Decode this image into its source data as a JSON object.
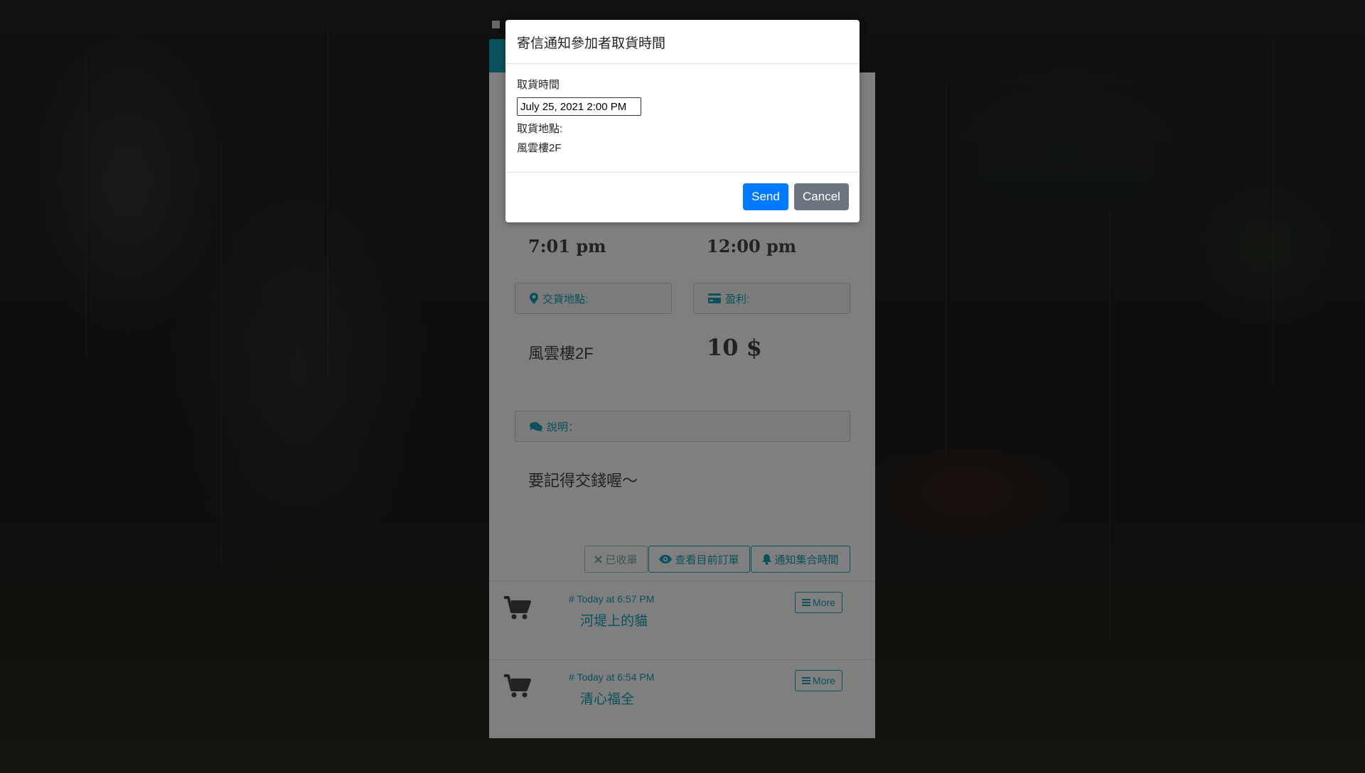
{
  "background": {
    "theme": "rainy-window-photo"
  },
  "card": {
    "start_time": "7:01 pm",
    "end_time": "12:00 pm",
    "location_label": "交貨地點:",
    "location_value": "風雲樓2F",
    "profit_label": "盈利:",
    "profit_value": "10 $",
    "description_label": "說明：",
    "description_value": "要記得交錢喔～",
    "actions": {
      "closed_label": "已收單",
      "view_orders_label": "查看目前訂單",
      "notify_label": "通知集合時間"
    },
    "orders": [
      {
        "time": "Today at 6:57 PM",
        "title": "河堤上的貓",
        "more_label": "More"
      },
      {
        "time": "Today at 6:54 PM",
        "title": "清心福全",
        "more_label": "More"
      }
    ]
  },
  "modal": {
    "title": "寄信通知參加者取貨時間",
    "pickup_time_label": "取貨時間",
    "pickup_time_value": "July 25, 2021 2:00 PM",
    "pickup_location_label": "取貨地點:",
    "pickup_location_value": "風雲樓2F",
    "send_label": "Send",
    "cancel_label": "Cancel"
  },
  "colors": {
    "accent": "#17a2b8",
    "primary": "#007bff",
    "secondary": "#6c757d"
  }
}
